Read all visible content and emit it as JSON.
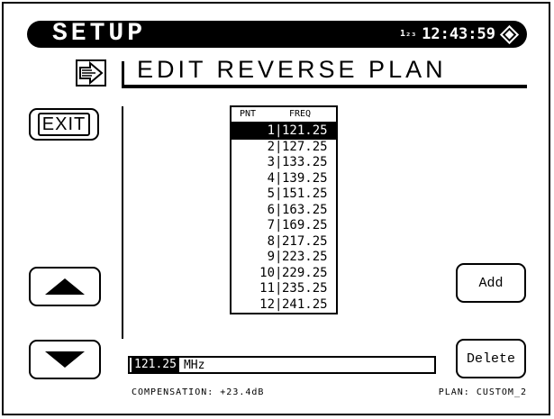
{
  "header": {
    "title": "SETUP",
    "mode": "1₂₃",
    "time": "12:43:59"
  },
  "page": {
    "title": "EDIT REVERSE PLAN"
  },
  "buttons": {
    "exit": "EXIT",
    "add": "Add",
    "delete": "Delete"
  },
  "table": {
    "col_pnt": "PNT",
    "col_freq": "FREQ",
    "selected_index": 0,
    "rows": [
      {
        "pnt": "1",
        "freq": "121.25"
      },
      {
        "pnt": "2",
        "freq": "127.25"
      },
      {
        "pnt": "3",
        "freq": "133.25"
      },
      {
        "pnt": "4",
        "freq": "139.25"
      },
      {
        "pnt": "5",
        "freq": "151.25"
      },
      {
        "pnt": "6",
        "freq": "163.25"
      },
      {
        "pnt": "7",
        "freq": "169.25"
      },
      {
        "pnt": "8",
        "freq": "217.25"
      },
      {
        "pnt": "9",
        "freq": "223.25"
      },
      {
        "pnt": "10",
        "freq": "229.25"
      },
      {
        "pnt": "11",
        "freq": "235.25"
      },
      {
        "pnt": "12",
        "freq": "241.25"
      }
    ]
  },
  "entry": {
    "value": "121.25",
    "unit": "MHz"
  },
  "footer": {
    "compensation": "COMPENSATION: +23.4dB",
    "plan": "PLAN: CUSTOM_2"
  },
  "icons": [
    "menu-arrow-icon",
    "up-arrow-icon",
    "down-arrow-icon",
    "diamond-icon"
  ]
}
